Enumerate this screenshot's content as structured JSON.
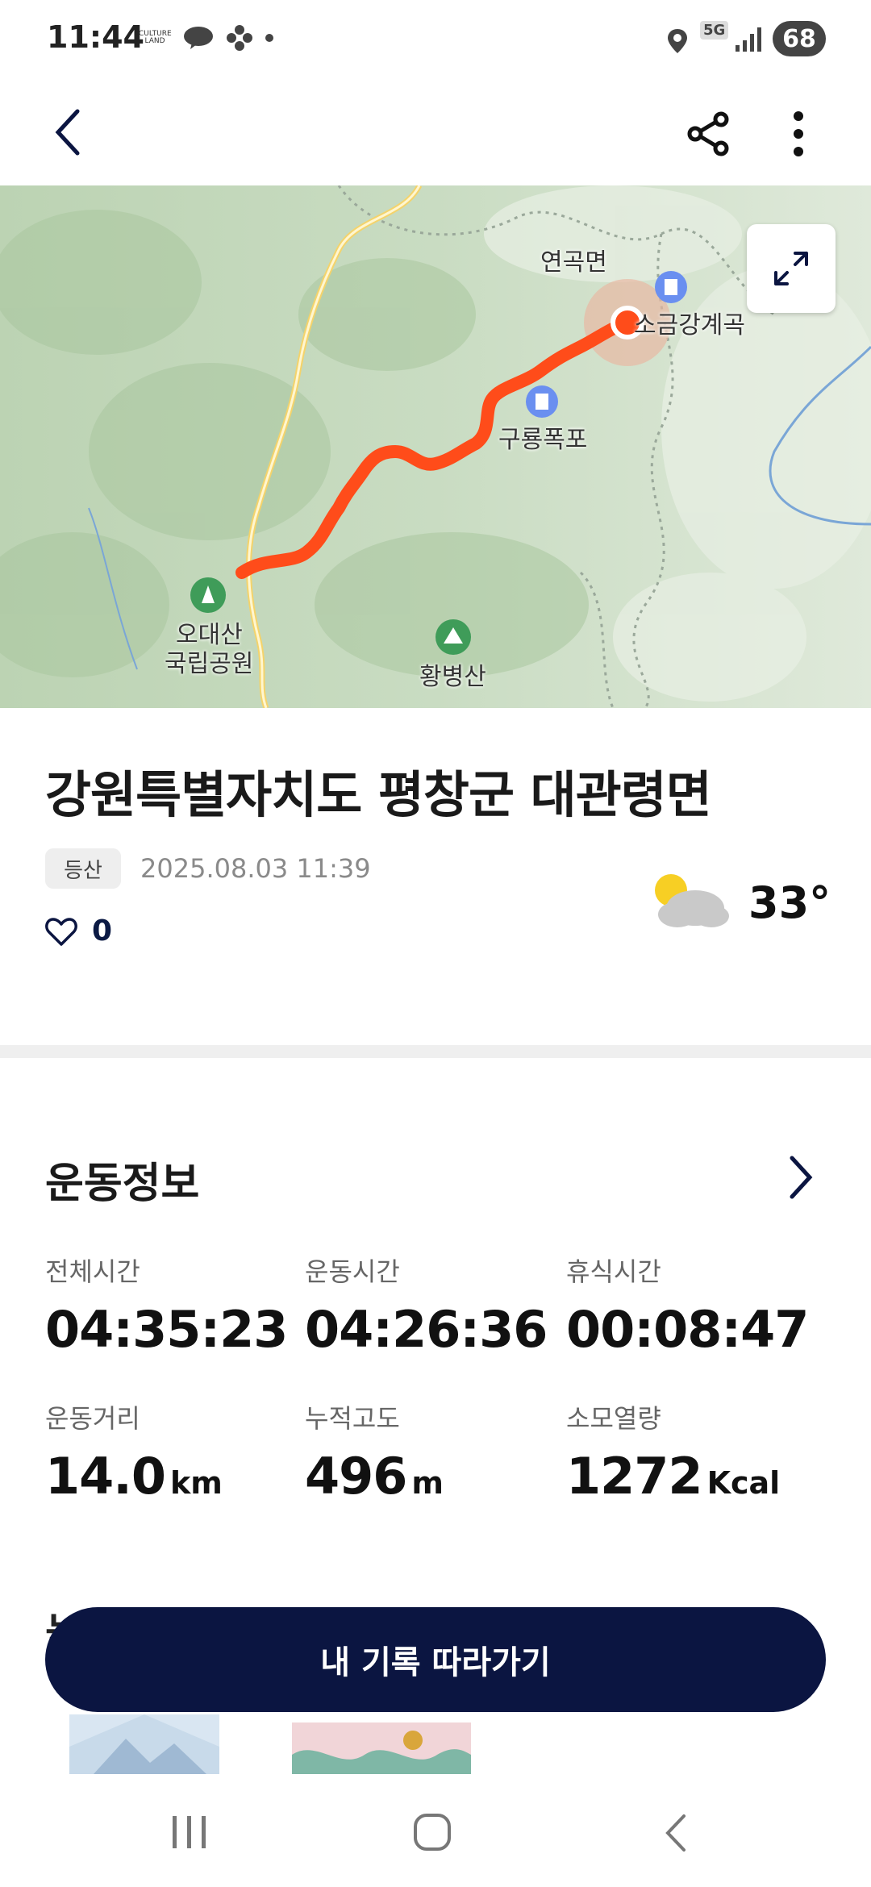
{
  "status_bar": {
    "time": "11:44",
    "network": "5G",
    "battery": "68",
    "culture_land_text": "CULTURE LAND"
  },
  "app_bar": {
    "back_icon": "back-arrow-icon",
    "share_icon": "share-icon",
    "more_icon": "more-vertical-icon"
  },
  "map": {
    "labels": {
      "yeongok": "연곡면",
      "sogeumgang": "소금강계곡",
      "guryong": "구룡폭포",
      "odaesan_line1": "오대산",
      "odaesan_line2": "국립공원",
      "hwangbyeong": "황병산"
    },
    "expand_icon": "expand-icon",
    "route_color": "#ff4c1a"
  },
  "activity": {
    "title": "강원특별자치도 평창군 대관령면",
    "category": "등산",
    "datetime": "2025.08.03 11:39",
    "likes": "0",
    "weather_icon": "partly-cloudy-icon",
    "temperature": "33°"
  },
  "exercise_info": {
    "heading": "운동정보",
    "stats": [
      {
        "label": "전체시간",
        "value": "04:35:23",
        "unit": ""
      },
      {
        "label": "운동시간",
        "value": "04:26:36",
        "unit": ""
      },
      {
        "label": "휴식시간",
        "value": "00:08:47",
        "unit": ""
      },
      {
        "label": "운동거리",
        "value": "14.0",
        "unit": "km"
      },
      {
        "label": "누적고도",
        "value": "496",
        "unit": "m"
      },
      {
        "label": "소모열량",
        "value": "1272",
        "unit": "Kcal"
      }
    ]
  },
  "peek_heading": "놓치지 마",
  "follow_button": "내 기록 따라가기",
  "colors": {
    "primary_navy": "#0b1541",
    "route_orange": "#ff4c1a"
  }
}
